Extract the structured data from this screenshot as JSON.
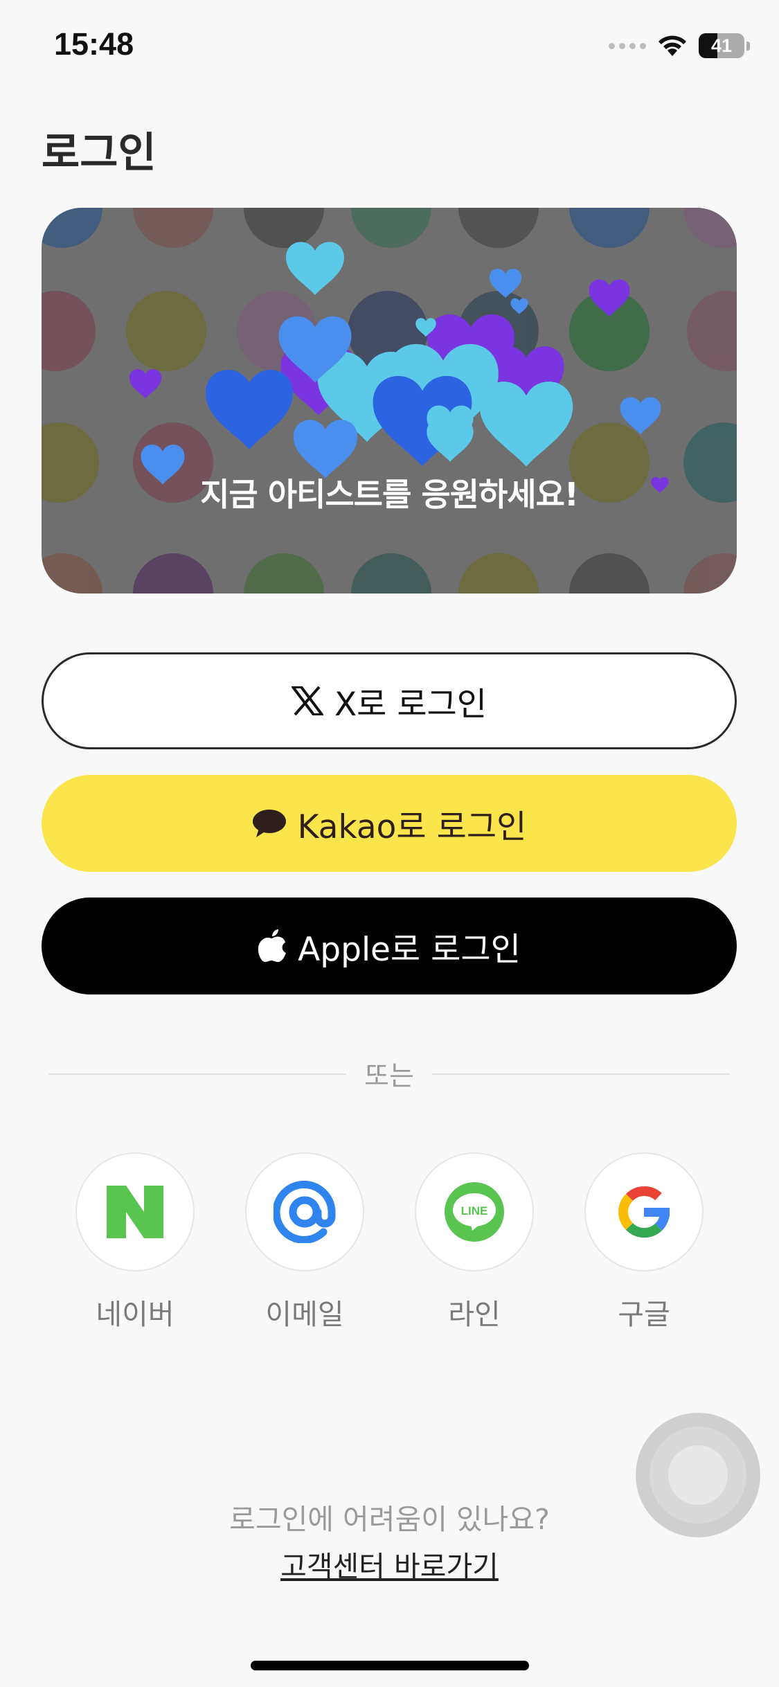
{
  "status_bar": {
    "time": "15:48",
    "battery": "41",
    "battery_level": 0.41
  },
  "page": {
    "title": "로그인"
  },
  "banner": {
    "caption": "지금 아티스트를 응원하세요!"
  },
  "login_buttons": {
    "x": {
      "label": "X로 로그인",
      "icon": "x-logo-icon"
    },
    "kakao": {
      "label": "Kakao로 로그인",
      "icon": "speech-bubble-icon"
    },
    "apple": {
      "label": "Apple로 로그인",
      "icon": "apple-logo-icon"
    }
  },
  "divider": {
    "text": "또는"
  },
  "social_logins": [
    {
      "label": "네이버",
      "icon": "naver-icon"
    },
    {
      "label": "이메일",
      "icon": "at-sign-icon"
    },
    {
      "label": "라인",
      "icon": "line-icon"
    },
    {
      "label": "구글",
      "icon": "google-icon"
    }
  ],
  "help": {
    "question": "로그인에 어려움이 있나요?",
    "link": "고객센터 바로가기"
  },
  "colors": {
    "kakao": "#fbe54d",
    "apple": "#000000",
    "naver": "#5ac451",
    "email": "#2f84ed",
    "line": "#5ac451",
    "background": "#f8f8f8"
  }
}
